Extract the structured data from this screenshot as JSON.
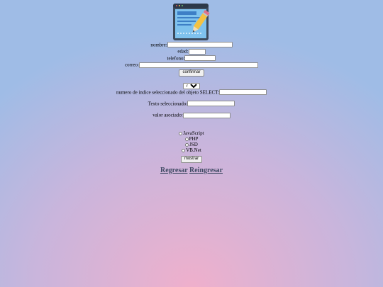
{
  "form": {
    "nombre_label": "nombre:",
    "edad_label": "edad:",
    "telefono_label": "telefono:",
    "correo_label": "correo:",
    "confirm_label": "confirmar"
  },
  "select": {
    "selected": "rojo",
    "index_label": "numero de indice seleccionado del objeto SELECT:",
    "text_label": "Texto seleccionado:",
    "value_label": "valor asociado:"
  },
  "checkboxes": [
    {
      "label": "JavaScript",
      "checked": false
    },
    {
      "label": "PHP",
      "checked": false
    },
    {
      "label": "JSD",
      "checked": false
    },
    {
      "label": "VB.Net",
      "checked": false
    }
  ],
  "show_label": "mostrar",
  "links": {
    "regresar": "Regresar",
    "reingresar": "Reingresar"
  },
  "colors": {
    "link": "#3f4a64",
    "bg_center": "#efb0cc",
    "bg_edge": "#9fbce6"
  },
  "icons": {
    "logo": "form-edit-pencil-icon"
  }
}
